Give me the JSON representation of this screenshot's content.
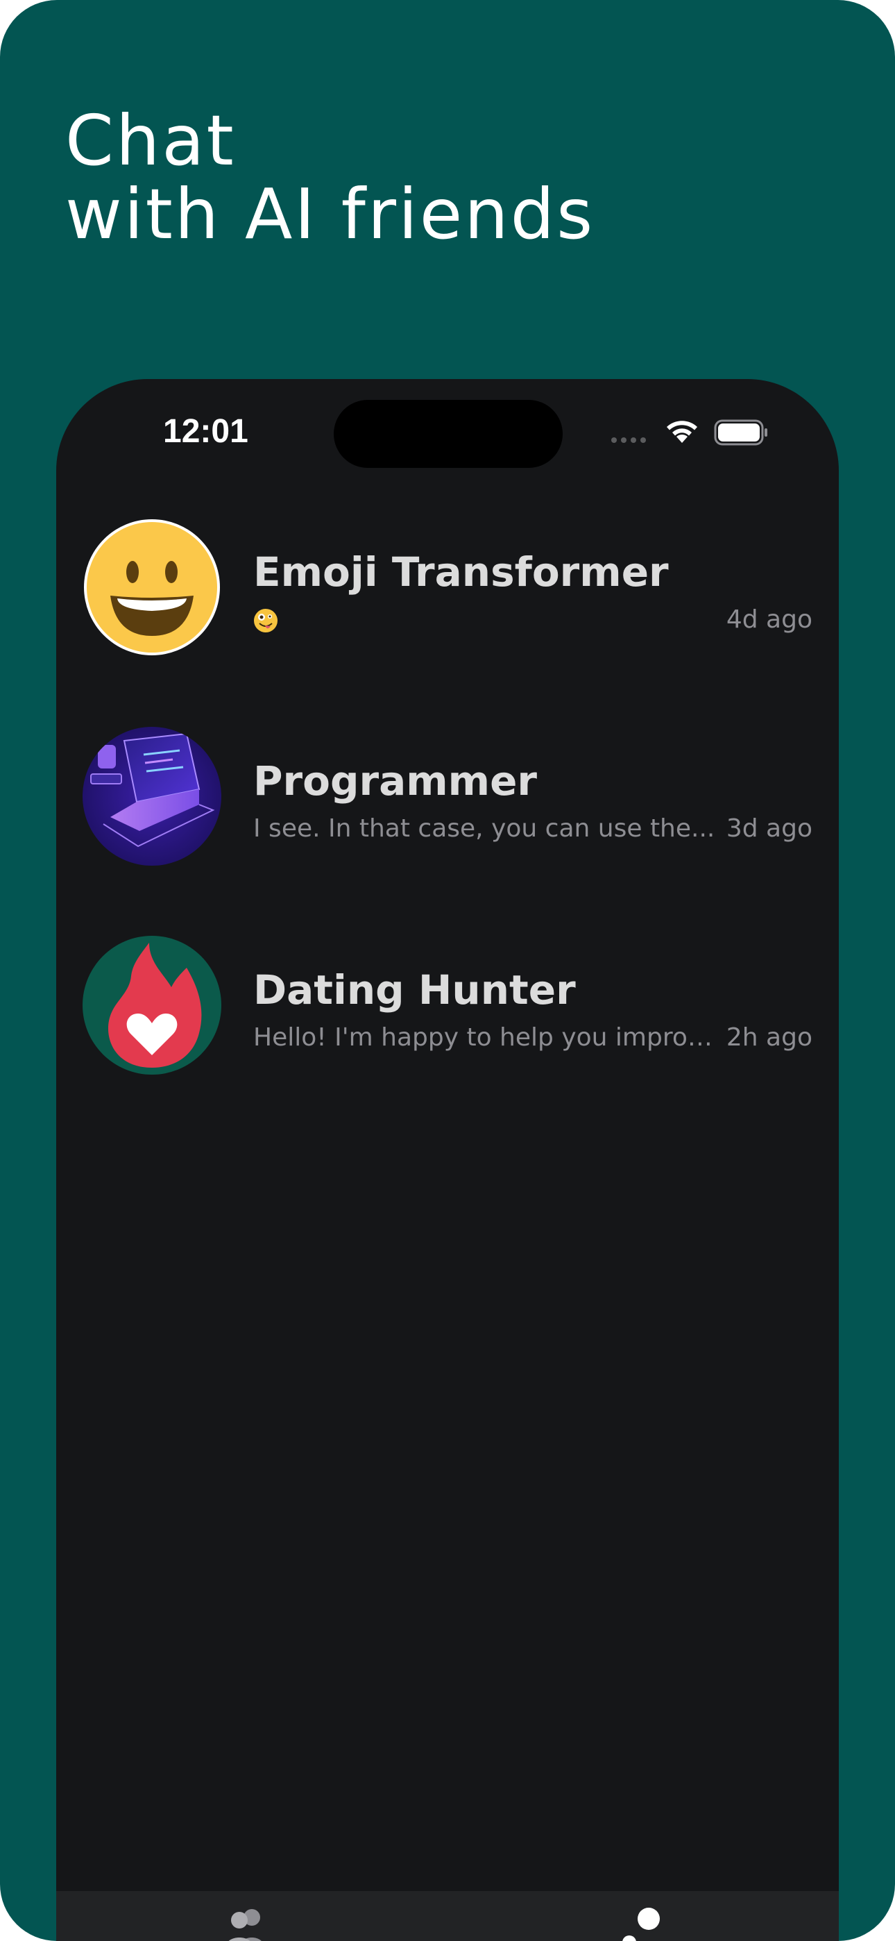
{
  "headline": {
    "line1": "Chat",
    "line2": "with AI friends"
  },
  "status_bar": {
    "time": "12:01",
    "icons": [
      "cellular-signal-icon",
      "wifi-icon",
      "battery-icon"
    ]
  },
  "chats": [
    {
      "name": "Emoji Transformer",
      "preview": "🤪",
      "time": "4d ago",
      "avatar": "smiley-face-avatar"
    },
    {
      "name": "Programmer",
      "preview": "I see. In that case, you can use the...",
      "time": "3d ago",
      "avatar": "laptop-avatar"
    },
    {
      "name": "Dating Hunter",
      "preview": "Hello! I'm happy to help you improv...",
      "time": "2h ago",
      "avatar": "flame-heart-avatar"
    }
  ],
  "tab_bar": {
    "tabs": [
      "friends-tab-icon",
      "profile-tab-icon"
    ]
  },
  "colors": {
    "background": "#035552",
    "phone_screen": "#151618",
    "tab_bar": "#222325",
    "name_text": "#dcdcdc",
    "secondary_text": "#8e8e93"
  }
}
